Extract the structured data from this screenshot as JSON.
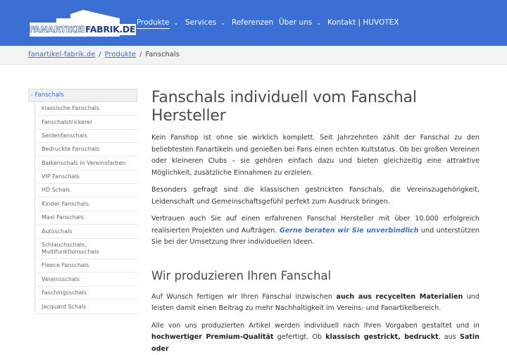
{
  "header": {
    "logo_text_1": "FANARTIKEL",
    "logo_text_2": "FABRIK.DE",
    "nav": [
      {
        "label": "Produkte",
        "has_dropdown": true,
        "active": true
      },
      {
        "label": "Services",
        "has_dropdown": true,
        "active": false
      },
      {
        "label": "Referenzen",
        "has_dropdown": false,
        "active": false
      },
      {
        "label": "Über uns",
        "has_dropdown": true,
        "active": false
      },
      {
        "label": "Kontakt | HUVOTEX",
        "has_dropdown": false,
        "active": false
      }
    ],
    "dropdown_icon": "chevron-down-icon"
  },
  "breadcrumb": {
    "items": [
      "fanartikel-fabrik.de",
      "Produkte"
    ],
    "separator": "/",
    "current": "Fanschals"
  },
  "sidebar": {
    "heading": "Fanschals",
    "heading_icon": "chevron-right-icon",
    "items": [
      "klassische Fanschals",
      "Fanschalstrickerei",
      "Seidenfanschals",
      "Bedruckte Fanschals",
      "Balkenschals in Vereinsfarben",
      "VIP Fanschals",
      "HD Schals",
      "Kinder Fanschals",
      "Maxi Fanschals",
      "Autoschals",
      "Schlauchschals, Multifunktionsschals",
      "Fleece Fanschals",
      "Vereinsschals",
      "Faschingsschals",
      "Jacquard Schals"
    ]
  },
  "main": {
    "title": "Fanschals individuell vom Fanschal Hersteller",
    "p1": "Kein Fanshop ist ohne sie wirklich komplett. Seit Jahrzehnten zählt der Fanschal zu den beliebtesten Fanartikeln und genießen bei Fans einen echten Kultstatus. Ob bei großen Vereinen oder kleineren Clubs – sie gehören einfach dazu und bieten gleichzeitig eine attraktive Möglichkeit, zusätzliche Einnahmen zu erzielen.",
    "p2": "Besonders gefragt sind die klassischen gestrickten Fanschals, die Vereinszugehörigkeit, Leidenschaft und Gemeinschaftsgefühl perfekt zum Ausdruck bringen.",
    "p3_a": "Vertrauen auch Sie auf einen erfahrenen Fanschal Hersteller mit über 10.000 erfolgreich realisierten Projekten und Aufträgen. ",
    "p3_link": "Gerne beraten wir Sie unverbindlich",
    "p3_b": " und unterstützen Sie bei der Umsetzung Ihrer individuellen Ideen.",
    "h2": "Wir produzieren Ihren Fanschal",
    "p4_a": "Auf Wunsch fertigen wir Ihren Fanschal inzwischen ",
    "p4_bold": "auch aus recycelten Materialien",
    "p4_b": " und leisten damit einen Beitrag zu mehr Nachhaltigkeit im Vereins- und Fanartikelbereich.",
    "p5_a": "Alle von uns produzierten Artikel werden individuell nach Ihren Vorgaben gestaltet und in ",
    "p5_bold1": "hochwertiger Premium-Qualität",
    "p5_b": " gefertigt. Ob ",
    "p5_bold2": "klassisch gestrickt, bedruckt",
    "p5_c": ", aus ",
    "p5_bold3": "Satin oder"
  },
  "colors": {
    "header_bg": "#3b6fd4",
    "link": "#3b6fd4",
    "breadcrumb_bg": "#f3f3f3"
  }
}
